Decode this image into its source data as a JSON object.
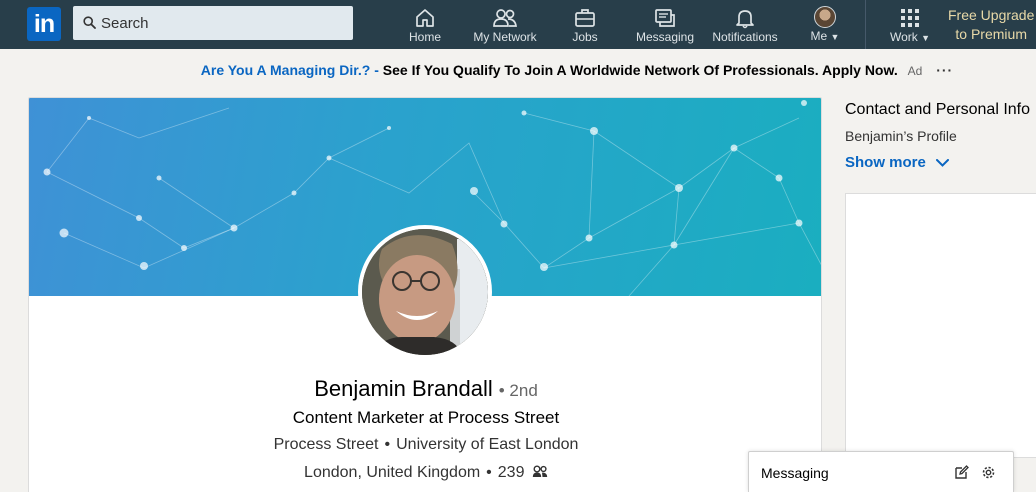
{
  "nav": {
    "logo_text": "in",
    "search_placeholder": "Search",
    "items": [
      {
        "label": "Home",
        "icon": "home-icon"
      },
      {
        "label": "My Network",
        "icon": "network-icon"
      },
      {
        "label": "Jobs",
        "icon": "briefcase-icon"
      },
      {
        "label": "Messaging",
        "icon": "messaging-icon"
      },
      {
        "label": "Notifications",
        "icon": "bell-icon"
      },
      {
        "label": "Me",
        "icon": "avatar"
      }
    ],
    "work_label": "Work",
    "premium_line1": "Free Upgrade",
    "premium_line2": "to Premium"
  },
  "ad": {
    "link_text": "Are You A Managing Dir.? -",
    "body_text": "See If You Qualify To Join A Worldwide Network Of Professionals. Apply Now.",
    "ad_label": "Ad",
    "more": "···"
  },
  "profile": {
    "name": "Benjamin Brandall",
    "degree": "• 2nd",
    "headline": "Content Marketer at Process Street",
    "company": "Process Street",
    "school": "University of East London",
    "location": "London, United Kingdom",
    "connections": "239",
    "separator": "•"
  },
  "contact": {
    "title": "Contact and Personal Info",
    "subtitle": "Benjamin’s Profile",
    "show_more": "Show more"
  },
  "messaging": {
    "title": "Messaging"
  },
  "colors": {
    "nav_bg": "#283e4a",
    "brand_blue": "#0a66c2",
    "premium_gold": "#e8d9a8"
  }
}
